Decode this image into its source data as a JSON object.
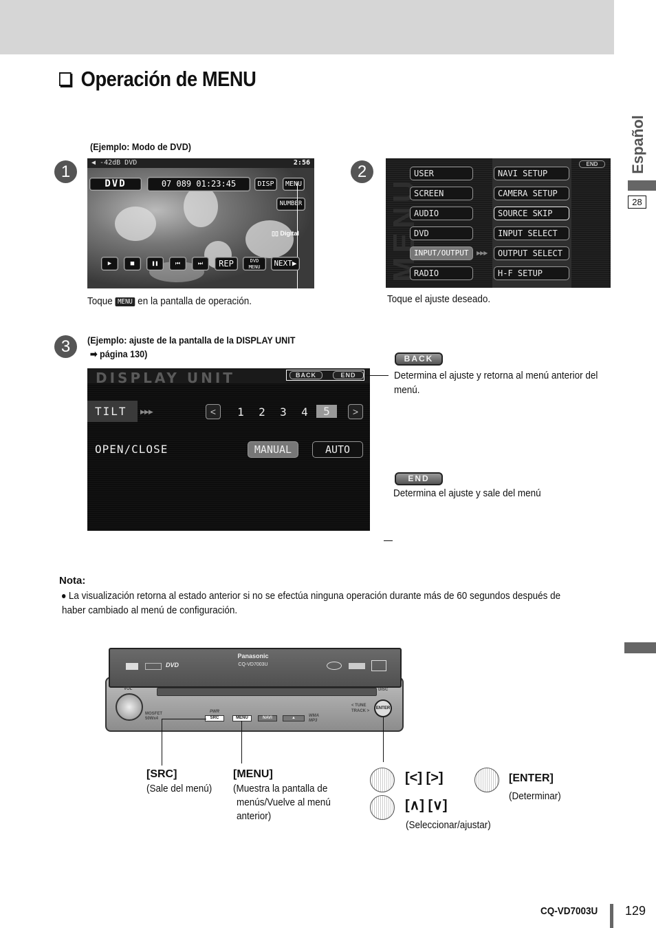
{
  "header": {
    "title": "Operación de MENU"
  },
  "side_tab": {
    "language": "Español",
    "section_number": "28"
  },
  "step1": {
    "number": "1",
    "example_label": "(Ejemplo: Modo de DVD)",
    "screen": {
      "status_left": "-42dB  DVD",
      "clock": "2:56",
      "source": "DVD",
      "track_info": "07  089  01:23:45",
      "disp_button": "DISP",
      "menu_button": "MENU",
      "number_button": "NUMBER",
      "digital_badge": "Digital",
      "controls": [
        "▶",
        "■",
        "❚❚",
        "⏮",
        "⏭",
        "REP",
        "DVD MENU",
        "NEXT▶"
      ]
    },
    "instruction_prefix": "Toque",
    "instruction_icon": "MENU",
    "instruction_suffix": "en la pantalla de operación."
  },
  "step2": {
    "number": "2",
    "screen": {
      "watermark": "MENU",
      "end_button": "END",
      "left_column": [
        "USER",
        "SCREEN",
        "AUDIO",
        "DVD",
        "INPUT/OUTPUT",
        "RADIO"
      ],
      "right_column": [
        "NAVI SETUP",
        "CAMERA SETUP",
        "SOURCE SKIP",
        "INPUT SELECT",
        "OUTPUT SELECT",
        "H-F SETUP"
      ],
      "selected_left": "INPUT/OUTPUT",
      "highlighted_right": "SOURCE SKIP"
    },
    "instruction": "Toque el ajuste deseado."
  },
  "step3": {
    "number": "3",
    "example_label_line1": "(Ejemplo: ajuste de la pantalla de la DISPLAY UNIT",
    "example_label_line2": "➡ página 130)",
    "screen": {
      "title": "DISPLAY UNIT",
      "back_button": "BACK",
      "end_button": "END",
      "tilt_label": "TILT",
      "tilt_prev": "<",
      "tilt_next": ">",
      "tilt_values": [
        "1",
        "2",
        "3",
        "4",
        "5"
      ],
      "tilt_selected": "5",
      "open_close_label": "OPEN/CLOSE",
      "manual_button": "MANUAL",
      "auto_button": "AUTO",
      "open_close_selected": "MANUAL"
    },
    "legend": [
      {
        "button": "BACK",
        "description": "Determina el ajuste y retorna al menú anterior del menú."
      },
      {
        "button": "END",
        "description": "Determina el ajuste y sale del menú"
      }
    ]
  },
  "note": {
    "title": "Nota:",
    "items": [
      "La visualización retorna al estado anterior si no se efectúa ninguna operación durante más de 60 segundos después de haber cambiado al menú de configuración."
    ]
  },
  "head_unit": {
    "brand": "Panasonic",
    "model": "CQ-VD7003U",
    "labels": {
      "vol": "VOL",
      "disc": "DISC",
      "pwr": "PWR",
      "tune_track": "< TUNE TRACK >",
      "mosfet": "MOSFET 50Wx4",
      "wma": "WMA MP3"
    },
    "buttons": [
      "SRC",
      "MENU",
      "NAVI",
      "▲"
    ],
    "enter": "ENTER"
  },
  "keys": {
    "src": {
      "title": "[SRC]",
      "description": "(Sale del menú)"
    },
    "menu": {
      "title": "[MENU]",
      "description_lines": [
        "(Muestra la pantalla de",
        "menús/Vuelve al menú",
        "anterior)"
      ]
    },
    "left_right": {
      "title": "[<] [>]"
    },
    "up_down": {
      "title": "[∧] [∨]",
      "description": "(Seleccionar/ajustar)"
    },
    "enter": {
      "title": "[ENTER]",
      "description": "(Determinar)"
    }
  },
  "footer": {
    "model": "CQ-VD7003U",
    "page_number": "129"
  }
}
